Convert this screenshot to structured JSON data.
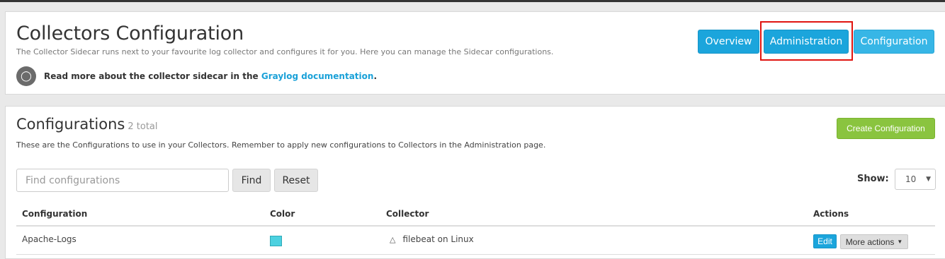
{
  "header": {
    "title": "Collectors Configuration",
    "subtitle": "The Collector Sidecar runs next to your favourite log collector and configures it for you. Here you can manage the Sidecar configurations.",
    "info_text": "Read more about the collector sidecar in the ",
    "info_link": "Graylog documentation",
    "info_suffix": ".",
    "nav": {
      "overview": "Overview",
      "administration": "Administration",
      "configuration": "Configuration"
    }
  },
  "configurations": {
    "title": "Configurations",
    "count": "2 total",
    "description": "These are the Configurations to use in your Collectors. Remember to apply new configurations to Collectors in the Administration page.",
    "create_label": "Create Configuration",
    "search": {
      "placeholder": "Find configurations",
      "find_label": "Find",
      "reset_label": "Reset"
    },
    "show_label": "Show:",
    "page_size": "10",
    "columns": [
      "Configuration",
      "Color",
      "Collector",
      "Actions"
    ],
    "rows": [
      {
        "name": "Apache-Logs",
        "color": "#4cd1e0",
        "collector": "filebeat on Linux",
        "collector_icon": "linux-icon",
        "edit_label": "Edit",
        "more_label": "More actions"
      }
    ]
  },
  "colors": {
    "primary": "#1ba5dc",
    "success": "#8ac43f",
    "link": "#1aa1d8",
    "highlight": "#e0140f"
  }
}
